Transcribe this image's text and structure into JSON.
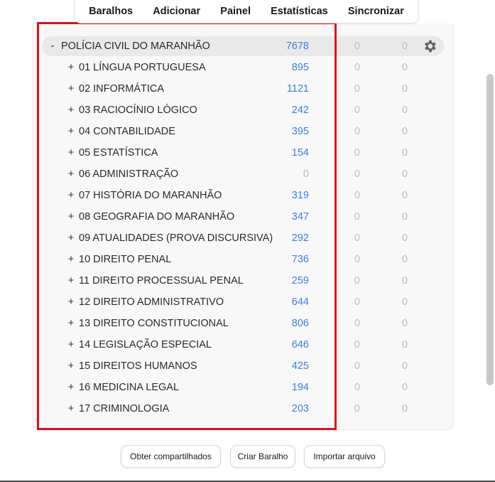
{
  "nav": {
    "items": [
      "Baralhos",
      "Adicionar",
      "Painel",
      "Estatísticas",
      "Sincronizar"
    ]
  },
  "colors": {
    "accent_blue": "#3f7de0",
    "highlight_red": "#e0101b",
    "muted_gray": "#bdbdbd"
  },
  "parent_deck": {
    "toggle": "-",
    "name": "POLÍCIA CIVIL DO MARANHÃO",
    "new": "7678",
    "learn": "0",
    "due": "0",
    "options_icon": "gear-icon"
  },
  "decks": [
    {
      "toggle": "+",
      "name": "01 LÍNGUA PORTUGUESA",
      "new": "895",
      "learn": "0",
      "due": "0"
    },
    {
      "toggle": "+",
      "name": "02 INFORMÁTICA",
      "new": "1121",
      "learn": "0",
      "due": "0"
    },
    {
      "toggle": "+",
      "name": "03 RACIOCÍNIO LÓGICO",
      "new": "242",
      "learn": "0",
      "due": "0"
    },
    {
      "toggle": "+",
      "name": "04 CONTABILIDADE",
      "new": "395",
      "learn": "0",
      "due": "0"
    },
    {
      "toggle": "+",
      "name": "05 ESTATÍSTICA",
      "new": "154",
      "learn": "0",
      "due": "0"
    },
    {
      "toggle": "+",
      "name": "06 ADMINISTRAÇÃO",
      "new": "0",
      "learn": "0",
      "due": "0"
    },
    {
      "toggle": "+",
      "name": "07 HISTÓRIA DO MARANHÃO",
      "new": "319",
      "learn": "0",
      "due": "0"
    },
    {
      "toggle": "+",
      "name": "08 GEOGRAFIA DO MARANHÃO",
      "new": "347",
      "learn": "0",
      "due": "0"
    },
    {
      "toggle": "+",
      "name": "09 ATUALIDADES (PROVA DISCURSIVA)",
      "new": "292",
      "learn": "0",
      "due": "0"
    },
    {
      "toggle": "+",
      "name": "10 DIREITO PENAL",
      "new": "736",
      "learn": "0",
      "due": "0"
    },
    {
      "toggle": "+",
      "name": "11 DIREITO PROCESSUAL PENAL",
      "new": "259",
      "learn": "0",
      "due": "0"
    },
    {
      "toggle": "+",
      "name": "12 DIREITO ADMINISTRATIVO",
      "new": "644",
      "learn": "0",
      "due": "0"
    },
    {
      "toggle": "+",
      "name": "13 DIREITO CONSTITUCIONAL",
      "new": "806",
      "learn": "0",
      "due": "0"
    },
    {
      "toggle": "+",
      "name": "14 LEGISLAÇÃO ESPECIAL",
      "new": "646",
      "learn": "0",
      "due": "0"
    },
    {
      "toggle": "+",
      "name": "15 DIREITOS HUMANOS",
      "new": "425",
      "learn": "0",
      "due": "0"
    },
    {
      "toggle": "+",
      "name": "16 MEDICINA LEGAL",
      "new": "194",
      "learn": "0",
      "due": "0"
    },
    {
      "toggle": "+",
      "name": "17 CRIMINOLOGIA",
      "new": "203",
      "learn": "0",
      "due": "0"
    }
  ],
  "buttons": {
    "shared": "Obter compartilhados",
    "create": "Criar Baralho",
    "import": "Importar arquivo"
  }
}
